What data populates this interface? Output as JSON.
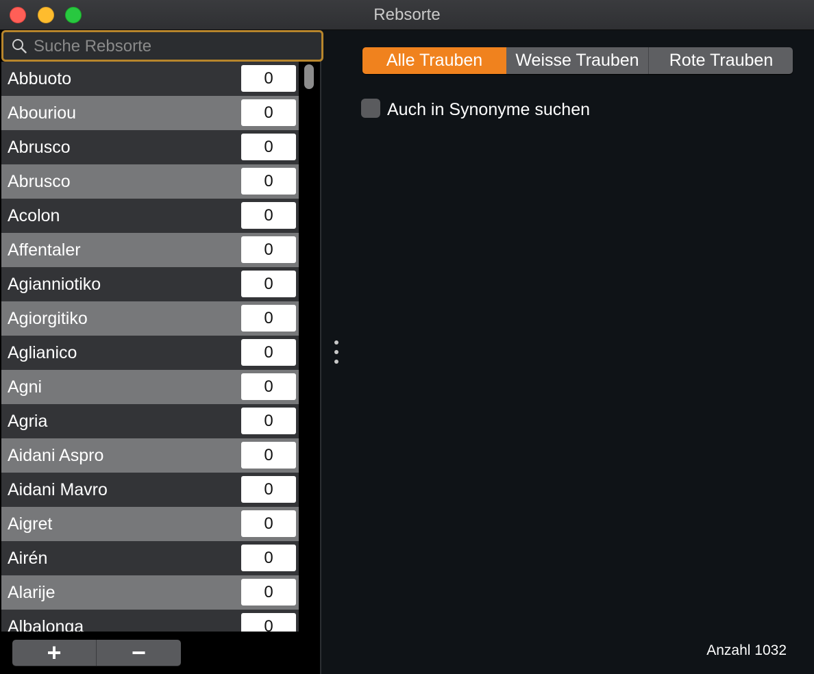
{
  "window": {
    "title": "Rebsorte"
  },
  "search": {
    "placeholder": "Suche Rebsorte",
    "value": ""
  },
  "grapes": [
    {
      "name": "Abbuoto",
      "count": "0"
    },
    {
      "name": "Abouriou",
      "count": "0"
    },
    {
      "name": "Abrusco",
      "count": "0"
    },
    {
      "name": "Abrusco",
      "count": "0"
    },
    {
      "name": "Acolon",
      "count": "0"
    },
    {
      "name": "Affentaler",
      "count": "0"
    },
    {
      "name": "Agianniotiko",
      "count": "0"
    },
    {
      "name": "Agiorgitiko",
      "count": "0"
    },
    {
      "name": "Aglianico",
      "count": "0"
    },
    {
      "name": "Agni",
      "count": "0"
    },
    {
      "name": "Agria",
      "count": "0"
    },
    {
      "name": "Aidani Aspro",
      "count": "0"
    },
    {
      "name": "Aidani Mavro",
      "count": "0"
    },
    {
      "name": "Aigret",
      "count": "0"
    },
    {
      "name": "Airén",
      "count": "0"
    },
    {
      "name": "Alarije",
      "count": "0"
    },
    {
      "name": "Albalonga",
      "count": "0"
    }
  ],
  "toolbar": {
    "add_label": "+",
    "remove_label": "−"
  },
  "filter": {
    "segments": [
      "Alle Trauben",
      "Weisse Trauben",
      "Rote Trauben"
    ],
    "selected": "Alle Trauben"
  },
  "synonyms": {
    "label": "Auch in Synonyme suchen",
    "checked": false
  },
  "footer": {
    "count_text": "Anzahl 1032"
  },
  "colors": {
    "accent": "#f0821e",
    "focus_ring": "#b8862c",
    "row_dark": "#333437",
    "row_light": "#77787a"
  },
  "icons": {
    "search": "magnifier",
    "splitter": "vertical-ellipsis"
  }
}
